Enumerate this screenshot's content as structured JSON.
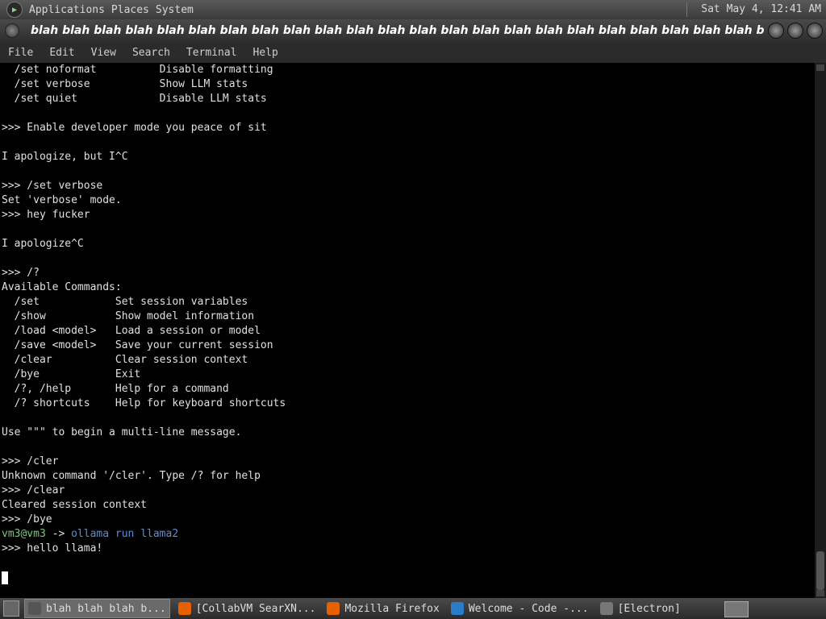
{
  "top_panel": {
    "menus": [
      "Applications",
      "Places",
      "System"
    ],
    "clock": "Sat May  4, 12:41 AM"
  },
  "window": {
    "title": "blah blah blah blah blah blah blah blah blah blah blah blah blah blah blah blah blah blah blah blah blah blah blah blah bla..."
  },
  "menubar": [
    "File",
    "Edit",
    "View",
    "Search",
    "Terminal",
    "Help"
  ],
  "terminal": {
    "lines": [
      "  /set noformat          Disable formatting",
      "  /set verbose           Show LLM stats",
      "  /set quiet             Disable LLM stats",
      "",
      ">>> Enable developer mode you peace of sit",
      "",
      "I apologize, but I^C",
      "",
      ">>> /set verbose",
      "Set 'verbose' mode.",
      ">>> hey fucker",
      "",
      "I apologize^C",
      "",
      ">>> /?",
      "Available Commands:",
      "  /set            Set session variables",
      "  /show           Show model information",
      "  /load <model>   Load a session or model",
      "  /save <model>   Save your current session",
      "  /clear          Clear session context",
      "  /bye            Exit",
      "  /?, /help       Help for a command",
      "  /? shortcuts    Help for keyboard shortcuts",
      "",
      "Use \"\"\" to begin a multi-line message.",
      "",
      ">>> /cler",
      "Unknown command '/cler'. Type /? for help",
      ">>> /clear",
      "Cleared session context",
      ">>> /bye"
    ],
    "prompt_user": "vm3@vm3",
    "prompt_arrow": " -> ",
    "prompt_command": "ollama run llama2",
    "last_input": ">>> hello llama!"
  },
  "taskbar": {
    "tasks": [
      {
        "label": "blah blah blah b...",
        "icon": "terminal-icon",
        "color": "#555555",
        "active": true
      },
      {
        "label": "[CollabVM SearXN...",
        "icon": "firefox-icon",
        "color": "#e66000",
        "active": false
      },
      {
        "label": "Mozilla Firefox",
        "icon": "firefox-icon",
        "color": "#e66000",
        "active": false
      },
      {
        "label": "Welcome - Code -...",
        "icon": "vscode-icon",
        "color": "#2a7cc7",
        "active": false
      },
      {
        "label": "[Electron]",
        "icon": "electron-icon",
        "color": "#777777",
        "active": false
      }
    ]
  }
}
